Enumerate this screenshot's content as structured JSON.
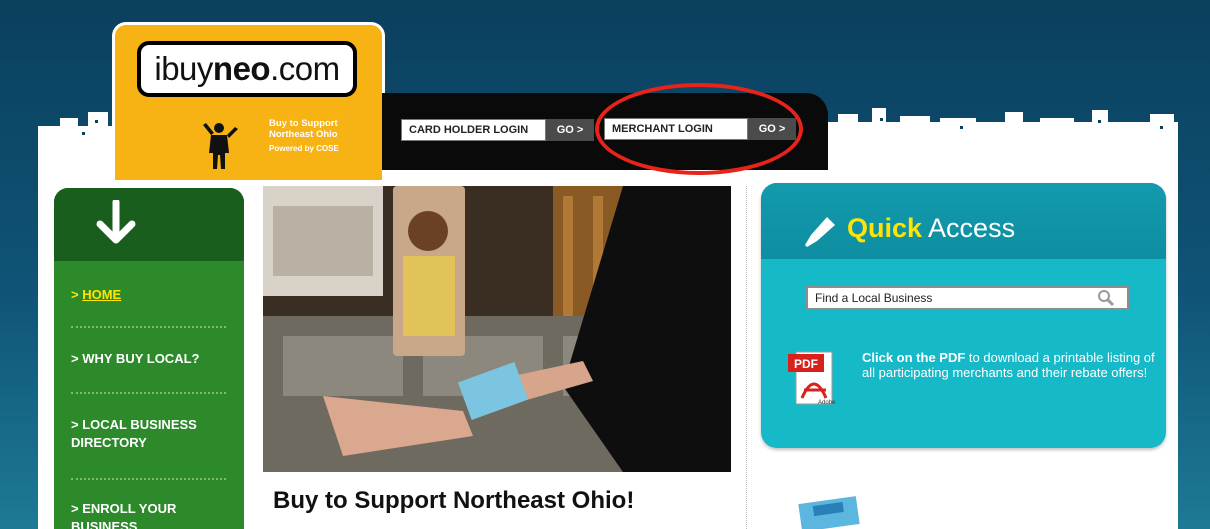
{
  "logo": {
    "brand_prefix": "ibuy",
    "brand_bold": "neo",
    "brand_suffix": ".com",
    "tagline_line1": "Buy to Support",
    "tagline_line2": "Northeast Ohio",
    "powered": "Powered by COSE"
  },
  "login": {
    "card_holder": "CARD HOLDER LOGIN",
    "merchant": "MERCHANT LOGIN",
    "go": "GO >"
  },
  "nav": {
    "items": [
      {
        "label": "HOME",
        "active": true
      },
      {
        "label": "WHY BUY LOCAL?",
        "active": false
      },
      {
        "label": "LOCAL BUSINESS DIRECTORY",
        "active": false
      },
      {
        "label": "ENROLL YOUR BUSINESS",
        "active": false
      }
    ],
    "marker": ">"
  },
  "main": {
    "headline": "Buy to Support Northeast Ohio!"
  },
  "quick_access": {
    "title_bold": "Quick",
    "title_rest": " Access",
    "search_placeholder": "Find a Local Business",
    "pdf_bold": "Click on the PDF",
    "pdf_rest": " to download a printable listing of all participating merchants and their rebate offers!",
    "pdf_icon_label": "PDF",
    "adobe_label": "Adobe"
  },
  "colors": {
    "logo_yellow": "#f7b214",
    "nav_green": "#2d8a2b",
    "qa_teal": "#16b9c8",
    "highlight_red": "#e8231a"
  }
}
